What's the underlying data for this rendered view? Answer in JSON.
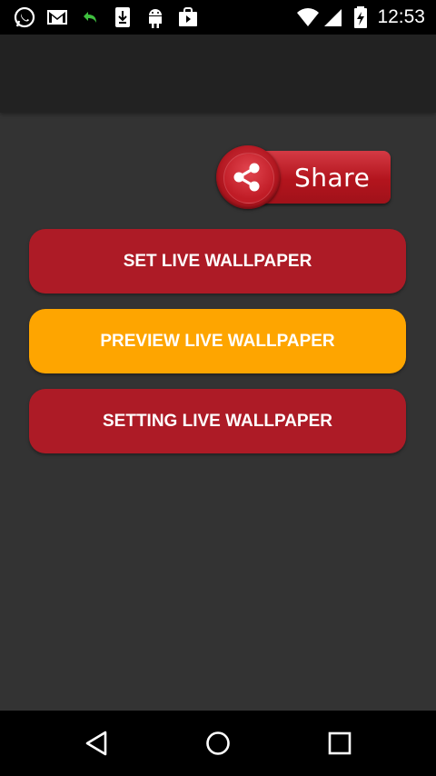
{
  "status_bar": {
    "time": "12:53",
    "icons": [
      "whatsapp-icon",
      "gmail-icon",
      "download-arrow-icon",
      "download-icon",
      "android-icon",
      "shopping-bag-icon",
      "wifi-icon",
      "signal-icon",
      "battery-charging-icon"
    ]
  },
  "share_button": {
    "label": "Share",
    "icon": "share-icon"
  },
  "buttons": {
    "set_live_wallpaper": "SET LIVE WALLPAPER",
    "preview_live_wallpaper": "PREVIEW LIVE WALLPAPER",
    "setting_live_wallpaper": "SETTING LIVE WALLPAPER"
  },
  "nav_bar": {
    "icons": [
      "back-icon",
      "home-icon",
      "recents-icon"
    ]
  },
  "colors": {
    "background": "#333333",
    "app_bar": "#222222",
    "button_red": "#ad1b26",
    "button_orange": "#fea500"
  }
}
